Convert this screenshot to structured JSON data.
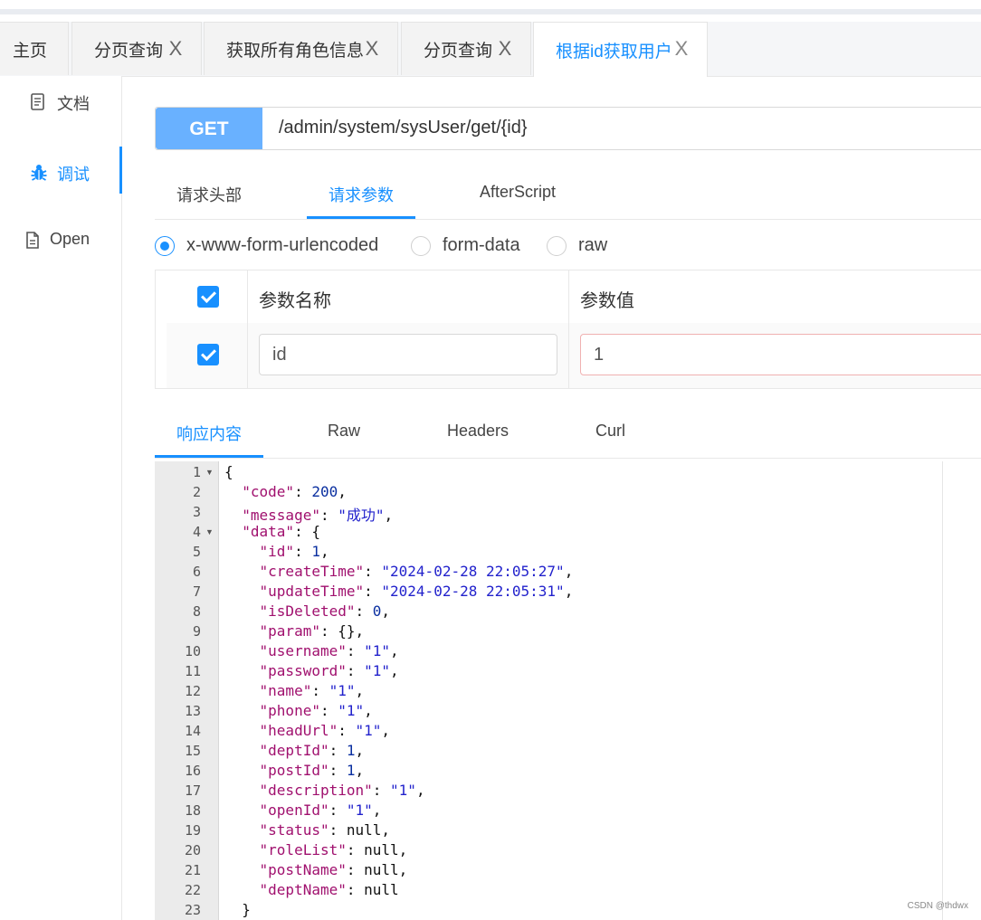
{
  "tabs": [
    {
      "label": "主页",
      "closable": false,
      "active": false
    },
    {
      "label": "分页查询",
      "closable": true,
      "active": false
    },
    {
      "label": "获取所有角色信息",
      "closable": true,
      "active": false
    },
    {
      "label": "分页查询",
      "closable": true,
      "active": false
    },
    {
      "label": "根据id获取用户",
      "closable": true,
      "active": true
    }
  ],
  "close_glyph": "X",
  "side_menu": [
    {
      "label": "文档",
      "icon": "document-icon"
    },
    {
      "label": "调试",
      "icon": "bug-icon",
      "active": true
    },
    {
      "label": "Open",
      "icon": "file-icon"
    }
  ],
  "request": {
    "method": "GET",
    "url": "/admin/system/sysUser/get/{id}"
  },
  "request_tabs": [
    {
      "label": "请求头部"
    },
    {
      "label": "请求参数",
      "active": true
    },
    {
      "label": "AfterScript"
    }
  ],
  "content_types": [
    {
      "label": "x-www-form-urlencoded",
      "checked": true
    },
    {
      "label": "form-data",
      "checked": false
    },
    {
      "label": "raw",
      "checked": false
    }
  ],
  "params_table": {
    "headers": [
      "参数名称",
      "参数值"
    ],
    "rows": [
      {
        "checked": true,
        "name": "id",
        "value": "1"
      }
    ]
  },
  "response_tabs": [
    {
      "label": "响应内容",
      "active": true
    },
    {
      "label": "Raw"
    },
    {
      "label": "Headers"
    },
    {
      "label": "Curl"
    }
  ],
  "response_lines": [
    {
      "no": "1",
      "fold": true,
      "tokens": [
        [
          "p",
          "{"
        ]
      ]
    },
    {
      "no": "2",
      "tokens": [
        [
          "p",
          "  "
        ],
        [
          "k",
          "\"code\""
        ],
        [
          "p",
          ": "
        ],
        [
          "n",
          "200"
        ],
        [
          "p",
          ","
        ]
      ]
    },
    {
      "no": "3",
      "tokens": [
        [
          "p",
          "  "
        ],
        [
          "k",
          "\"message\""
        ],
        [
          "p",
          ": "
        ],
        [
          "s",
          "\"成功\""
        ],
        [
          "p",
          ","
        ]
      ]
    },
    {
      "no": "4",
      "fold": true,
      "tokens": [
        [
          "p",
          "  "
        ],
        [
          "k",
          "\"data\""
        ],
        [
          "p",
          ": {"
        ]
      ]
    },
    {
      "no": "5",
      "tokens": [
        [
          "p",
          "    "
        ],
        [
          "k",
          "\"id\""
        ],
        [
          "p",
          ": "
        ],
        [
          "n",
          "1"
        ],
        [
          "p",
          ","
        ]
      ]
    },
    {
      "no": "6",
      "tokens": [
        [
          "p",
          "    "
        ],
        [
          "k",
          "\"createTime\""
        ],
        [
          "p",
          ": "
        ],
        [
          "s",
          "\"2024-02-28 22:05:27\""
        ],
        [
          "p",
          ","
        ]
      ]
    },
    {
      "no": "7",
      "tokens": [
        [
          "p",
          "    "
        ],
        [
          "k",
          "\"updateTime\""
        ],
        [
          "p",
          ": "
        ],
        [
          "s",
          "\"2024-02-28 22:05:31\""
        ],
        [
          "p",
          ","
        ]
      ]
    },
    {
      "no": "8",
      "tokens": [
        [
          "p",
          "    "
        ],
        [
          "k",
          "\"isDeleted\""
        ],
        [
          "p",
          ": "
        ],
        [
          "n",
          "0"
        ],
        [
          "p",
          ","
        ]
      ]
    },
    {
      "no": "9",
      "tokens": [
        [
          "p",
          "    "
        ],
        [
          "k",
          "\"param\""
        ],
        [
          "p",
          ": {},"
        ]
      ]
    },
    {
      "no": "10",
      "tokens": [
        [
          "p",
          "    "
        ],
        [
          "k",
          "\"username\""
        ],
        [
          "p",
          ": "
        ],
        [
          "s",
          "\"1\""
        ],
        [
          "p",
          ","
        ]
      ]
    },
    {
      "no": "11",
      "tokens": [
        [
          "p",
          "    "
        ],
        [
          "k",
          "\"password\""
        ],
        [
          "p",
          ": "
        ],
        [
          "s",
          "\"1\""
        ],
        [
          "p",
          ","
        ]
      ]
    },
    {
      "no": "12",
      "tokens": [
        [
          "p",
          "    "
        ],
        [
          "k",
          "\"name\""
        ],
        [
          "p",
          ": "
        ],
        [
          "s",
          "\"1\""
        ],
        [
          "p",
          ","
        ]
      ]
    },
    {
      "no": "13",
      "tokens": [
        [
          "p",
          "    "
        ],
        [
          "k",
          "\"phone\""
        ],
        [
          "p",
          ": "
        ],
        [
          "s",
          "\"1\""
        ],
        [
          "p",
          ","
        ]
      ]
    },
    {
      "no": "14",
      "tokens": [
        [
          "p",
          "    "
        ],
        [
          "k",
          "\"headUrl\""
        ],
        [
          "p",
          ": "
        ],
        [
          "s",
          "\"1\""
        ],
        [
          "p",
          ","
        ]
      ]
    },
    {
      "no": "15",
      "tokens": [
        [
          "p",
          "    "
        ],
        [
          "k",
          "\"deptId\""
        ],
        [
          "p",
          ": "
        ],
        [
          "n",
          "1"
        ],
        [
          "p",
          ","
        ]
      ]
    },
    {
      "no": "16",
      "tokens": [
        [
          "p",
          "    "
        ],
        [
          "k",
          "\"postId\""
        ],
        [
          "p",
          ": "
        ],
        [
          "n",
          "1"
        ],
        [
          "p",
          ","
        ]
      ]
    },
    {
      "no": "17",
      "tokens": [
        [
          "p",
          "    "
        ],
        [
          "k",
          "\"description\""
        ],
        [
          "p",
          ": "
        ],
        [
          "s",
          "\"1\""
        ],
        [
          "p",
          ","
        ]
      ]
    },
    {
      "no": "18",
      "tokens": [
        [
          "p",
          "    "
        ],
        [
          "k",
          "\"openId\""
        ],
        [
          "p",
          ": "
        ],
        [
          "s",
          "\"1\""
        ],
        [
          "p",
          ","
        ]
      ]
    },
    {
      "no": "19",
      "tokens": [
        [
          "p",
          "    "
        ],
        [
          "k",
          "\"status\""
        ],
        [
          "p",
          ": null,"
        ]
      ]
    },
    {
      "no": "20",
      "tokens": [
        [
          "p",
          "    "
        ],
        [
          "k",
          "\"roleList\""
        ],
        [
          "p",
          ": null,"
        ]
      ]
    },
    {
      "no": "21",
      "tokens": [
        [
          "p",
          "    "
        ],
        [
          "k",
          "\"postName\""
        ],
        [
          "p",
          ": null,"
        ]
      ]
    },
    {
      "no": "22",
      "tokens": [
        [
          "p",
          "    "
        ],
        [
          "k",
          "\"deptName\""
        ],
        [
          "p",
          ": null"
        ]
      ]
    },
    {
      "no": "23",
      "tokens": [
        [
          "p",
          "  }"
        ]
      ]
    }
  ],
  "watermark": "CSDN @thdwx",
  "colors": {
    "accent": "#1890ff",
    "method_bg": "#69b1ff",
    "json_key": "#a0106e",
    "json_string": "#2222cc",
    "json_number": "#0a2fa0"
  }
}
